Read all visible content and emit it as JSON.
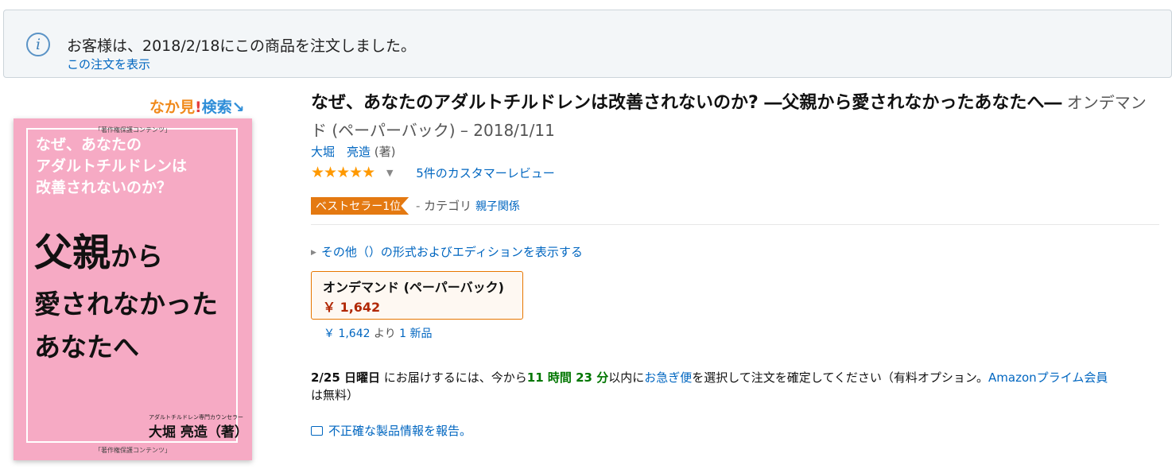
{
  "notice": {
    "icon": "info-icon",
    "message": "お客様は、2018/2/18にこの商品を注文しました。",
    "view_order": "この注文を表示"
  },
  "look_inside": {
    "part1": "なか見",
    "part2": "!",
    "part3": "検索",
    "arrow": "↘"
  },
  "cover": {
    "protect_top": "「著作権保護コンテンツ」",
    "sub_title": [
      "なぜ、あなたの",
      "アダルトチルドレンは",
      "改善されないのか？"
    ],
    "main_line1_big": "父親",
    "main_line1_small": "から",
    "main_line2": "愛されなかった",
    "main_line3": "あなたへ",
    "author_title": "アダルトチルドレン専門カウンセラー",
    "author": "大堀 亮造（著）",
    "protect_bottom": "「著作権保護コンテンツ」"
  },
  "product": {
    "title": "なぜ、あなたのアダルトチルドレンは改善されないのか? ―父親から愛されなかったあなたへ―",
    "format_date": " オンデマンド (ペーパーバック) – 2018/1/11",
    "author": "大堀　亮造",
    "author_role": " (著)",
    "stars": "★★★★★",
    "reviews": "5件のカスタマーレビュー",
    "bestseller_badge": "ベストセラー1位",
    "category_sep": " - ",
    "category_label": "カテゴリ",
    "category_link": "親子関係",
    "other_formats": "その他（）の形式およびエディションを表示する",
    "format_name": "オンデマンド (ペーパーバック)",
    "format_price": "￥ 1,642",
    "new_price": "￥ 1,642",
    "new_from_text": " より ",
    "new_count": "1 新品",
    "delivery": {
      "date": "2/25 日曜日",
      "text1": " にお届けするには、今から",
      "time": "11 時間 23 分",
      "text2": "以内に",
      "express": "お急ぎ便",
      "text3": "を選択して注文を確定してください（有料オプション。",
      "prime": "Amazonプライム会員",
      "text4": "は無料）"
    },
    "report": "不正確な製品情報を報告。"
  },
  "colors": {
    "link": "#0066c0",
    "price": "#b12704",
    "badge": "#e47911",
    "star": "#ff9900",
    "green": "#007600"
  }
}
